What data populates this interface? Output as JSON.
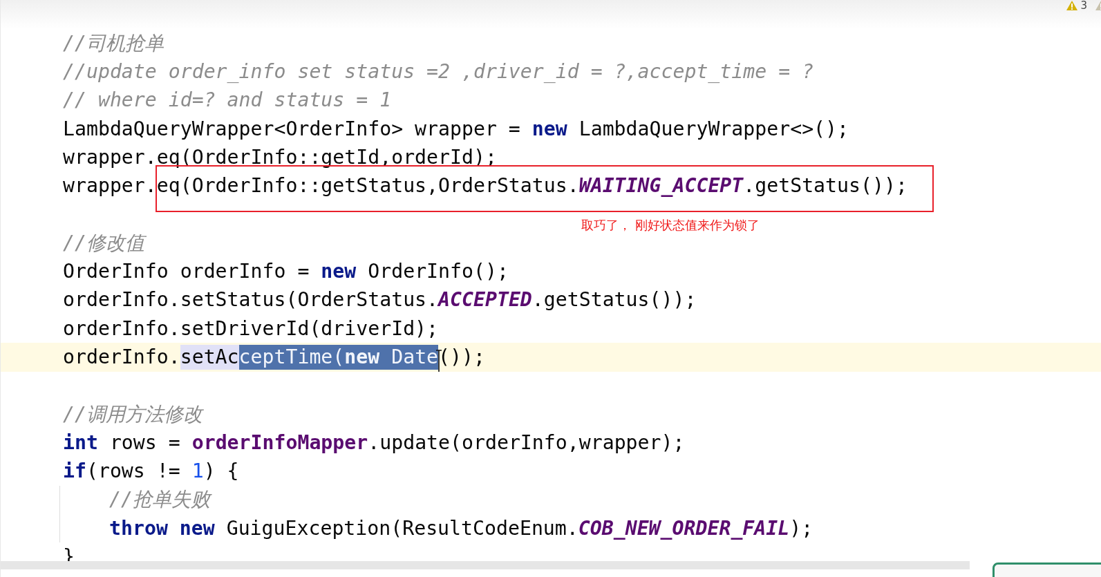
{
  "inspections": [
    {
      "kind": "warning",
      "count": "3"
    },
    {
      "kind": "weak"
    }
  ],
  "lines": [
    {
      "tokens": [
        {
          "kind": "comment",
          "text": "//司机抢单"
        }
      ]
    },
    {
      "tokens": [
        {
          "kind": "comment",
          "text": "//update order_info set status =2 ,driver_id = ?,accept_time = ?"
        }
      ]
    },
    {
      "tokens": [
        {
          "kind": "comment",
          "text": "// where id=? and status = 1"
        }
      ]
    },
    {
      "tokens": [
        {
          "kind": "plain",
          "text": "LambdaQueryWrapper<OrderInfo> wrapper = "
        },
        {
          "kind": "keyword",
          "text": "new"
        },
        {
          "kind": "plain",
          "text": " LambdaQueryWrapper<>();"
        }
      ]
    },
    {
      "tokens": [
        {
          "kind": "plain",
          "text": "wrapper.eq(OrderInfo::getId,orderId);"
        }
      ]
    },
    {
      "tokens": [
        {
          "kind": "plain",
          "text": "wrapper."
        },
        {
          "kind": "plain",
          "text": "eq(OrderInfo::getStatus,OrderStatus.",
          "boxed": true
        },
        {
          "kind": "field",
          "text": "WAITING_ACCEPT",
          "boxed": true
        },
        {
          "kind": "plain",
          "text": ".getStatus());",
          "boxed": true
        }
      ]
    },
    {
      "note": "取巧了， 刚好状态值来作为锁了"
    },
    {
      "tokens": [
        {
          "kind": "comment",
          "text": "//修改值"
        }
      ]
    },
    {
      "tokens": [
        {
          "kind": "plain",
          "text": "OrderInfo orderInfo = "
        },
        {
          "kind": "keyword",
          "text": "new"
        },
        {
          "kind": "plain",
          "text": " OrderInfo();"
        }
      ]
    },
    {
      "tokens": [
        {
          "kind": "plain",
          "text": "orderInfo.setStatus(OrderStatus."
        },
        {
          "kind": "field",
          "text": "ACCEPTED"
        },
        {
          "kind": "plain",
          "text": ".getStatus());"
        }
      ]
    },
    {
      "tokens": [
        {
          "kind": "plain",
          "text": "orderInfo.setDriverId(driverId);"
        }
      ]
    },
    {
      "current": true,
      "tokens": [
        {
          "kind": "plain",
          "text": "orderInfo."
        },
        {
          "kind": "plain",
          "text": "setAc",
          "occurrence": true
        },
        {
          "kind": "plain",
          "text": "ceptTime(",
          "selected": true
        },
        {
          "kind": "keyword",
          "text": "new",
          "selected": true
        },
        {
          "kind": "plain",
          "text": " Date",
          "selected": true,
          "caret": true
        },
        {
          "kind": "plain",
          "text": "());"
        }
      ]
    },
    {
      "kind": "blank"
    },
    {
      "tokens": [
        {
          "kind": "comment",
          "text": "//调用方法修改"
        }
      ]
    },
    {
      "tokens": [
        {
          "kind": "keyword",
          "text": "int"
        },
        {
          "kind": "plain",
          "text": " rows = "
        },
        {
          "kind": "member",
          "text": "orderInfoMapper"
        },
        {
          "kind": "plain",
          "text": ".update(orderInfo,wrapper);"
        }
      ]
    },
    {
      "tokens": [
        {
          "kind": "keyword",
          "text": "if"
        },
        {
          "kind": "plain",
          "text": "(rows != "
        },
        {
          "kind": "number",
          "text": "1"
        },
        {
          "kind": "plain",
          "text": ") {"
        }
      ]
    },
    {
      "guide": true,
      "tokens": [
        {
          "kind": "comment",
          "text": "//抢单失败"
        }
      ]
    },
    {
      "guide": true,
      "tokens": [
        {
          "kind": "keyword",
          "text": "throw"
        },
        {
          "kind": "keyword",
          "text": "new",
          "space_before": true
        },
        {
          "kind": "plain",
          "text": " GuiguException(ResultCodeEnum."
        },
        {
          "kind": "field",
          "text": "COB_NEW_ORDER_FAIL"
        },
        {
          "kind": "plain",
          "text": ");"
        }
      ]
    },
    {
      "tokens": [
        {
          "kind": "plain",
          "text": "}"
        }
      ]
    }
  ]
}
